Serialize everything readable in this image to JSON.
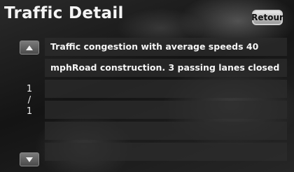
{
  "header": {
    "title": "Traffic Detail",
    "back_label": "Retour"
  },
  "pager": {
    "current": "1",
    "separator": "/",
    "total": "1"
  },
  "icons": {
    "scroll_up": "triangle-up",
    "scroll_down": "triangle-down"
  },
  "rows": [
    "Traffic congestion with average speeds 40",
    "mphRoad construction. 3 passing lanes closed",
    "",
    "",
    "",
    ""
  ]
}
